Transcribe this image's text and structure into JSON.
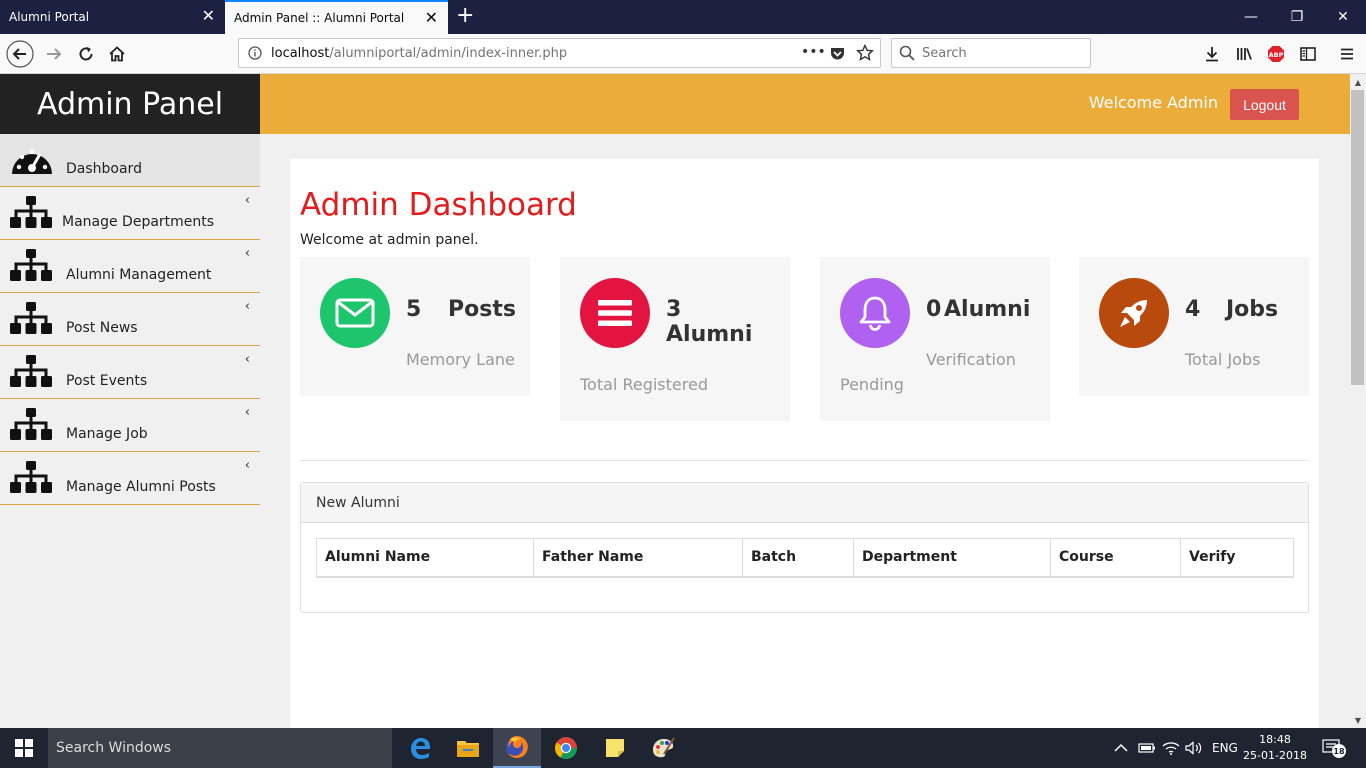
{
  "browser": {
    "tabs": [
      {
        "title": "Alumni Portal",
        "close": "✕"
      },
      {
        "title": "Admin Panel :: Alumni Portal",
        "close": "✕"
      }
    ],
    "new_tab": "+",
    "window_controls": {
      "minimize": "—",
      "restore": "❐",
      "close": "✕"
    },
    "url_host": "localhost",
    "url_path": "/alumniportal/admin/index-inner.php",
    "url_more": "•••",
    "search_placeholder": "Search"
  },
  "app": {
    "brand": "Admin Panel",
    "welcome": "Welcome Admin",
    "logout": "Logout"
  },
  "sidebar": {
    "items": [
      {
        "label": "Dashboard",
        "icon": "dashboard-gauge-icon",
        "chevron": ""
      },
      {
        "label": "Manage Departments",
        "icon": "sitemap-icon",
        "chevron": "‹"
      },
      {
        "label": "Alumni Management",
        "icon": "sitemap-icon",
        "chevron": "‹"
      },
      {
        "label": "Post News",
        "icon": "sitemap-icon",
        "chevron": "‹"
      },
      {
        "label": "Post Events",
        "icon": "sitemap-icon",
        "chevron": "‹"
      },
      {
        "label": "Manage Job",
        "icon": "sitemap-icon",
        "chevron": "‹"
      },
      {
        "label": "Manage Alumni Posts",
        "icon": "sitemap-icon",
        "chevron": "‹"
      }
    ]
  },
  "dashboard": {
    "title": "Admin Dashboard",
    "subtitle": "Welcome at admin panel.",
    "cards": [
      {
        "count": "5",
        "name": "Posts",
        "label": "Memory Lane",
        "icon": "envelope-icon",
        "color": "#1dc56d"
      },
      {
        "count": "3",
        "name": "Alumni",
        "label": "Total Registered",
        "icon": "list-icon",
        "color": "#e3143f"
      },
      {
        "count": "0",
        "name": "Alumni",
        "label_line1": "Verification",
        "label_line2": "Pending",
        "icon": "bell-icon",
        "color": "#b061f0"
      },
      {
        "count": "4",
        "name": "Jobs",
        "label": "Total Jobs",
        "icon": "rocket-icon",
        "color": "#b94a0e"
      }
    ]
  },
  "new_alumni": {
    "heading": "New Alumni",
    "columns": [
      "Alumni Name",
      "Father Name",
      "Batch",
      "Department",
      "Course",
      "Verify"
    ]
  },
  "taskbar": {
    "search": "Search Windows",
    "language": "ENG",
    "time": "18:48",
    "date": "25-01-2018",
    "notifications": "18"
  }
}
